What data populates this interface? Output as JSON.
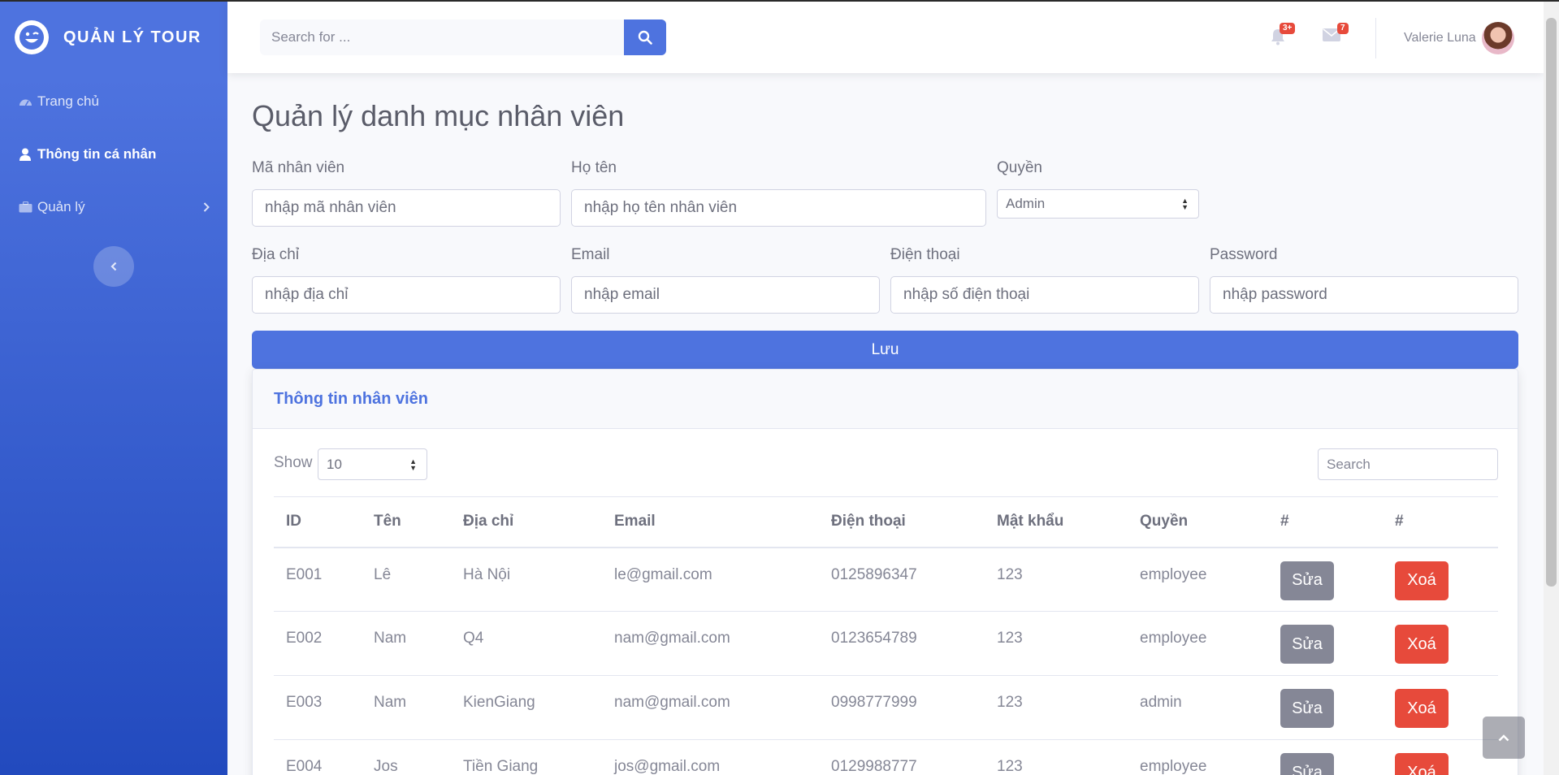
{
  "brand": {
    "name": "QUẢN LÝ TOUR",
    "logo_icon": "laugh-wink-icon"
  },
  "sidebar": {
    "items": [
      {
        "label": "Trang chủ",
        "icon": "tachometer-icon"
      },
      {
        "label": "Thông tin cá nhân",
        "icon": "user-icon"
      },
      {
        "label": "Quản lý",
        "icon": "briefcase-icon"
      }
    ]
  },
  "topbar": {
    "search_placeholder": "Search for ...",
    "alerts_badge": "3+",
    "messages_badge": "7",
    "user_name": "Valerie Luna"
  },
  "page": {
    "title": "Quản lý danh mục nhân viên"
  },
  "form": {
    "ma_label": "Mã nhân viên",
    "ma_placeholder": "nhập mã nhân viên",
    "hoten_label": "Họ tên",
    "hoten_placeholder": "nhập họ tên nhân viên",
    "quyen_label": "Quyền",
    "quyen_value": "Admin",
    "diachi_label": "Địa chỉ",
    "diachi_placeholder": "nhập địa chỉ",
    "email_label": "Email",
    "email_placeholder": "nhập email",
    "dienthoai_label": "Điện thoại",
    "dienthoai_placeholder": "nhập số điện thoại",
    "password_label": "Password",
    "password_placeholder": "nhập password",
    "save_label": "Lưu"
  },
  "table_card": {
    "title": "Thông tin nhân viên",
    "show_label": "Show",
    "page_size": "10",
    "search_placeholder": "Search",
    "columns": [
      "ID",
      "Tên",
      "Địa chỉ",
      "Email",
      "Điện thoại",
      "Mật khẩu",
      "Quyền",
      "#",
      "#"
    ],
    "edit_label": "Sửa",
    "delete_label": "Xoá",
    "rows": [
      [
        "E001",
        "Lê",
        "Hà Nội",
        "le@gmail.com",
        "0125896347",
        "123",
        "employee"
      ],
      [
        "E002",
        "Nam",
        "Q4",
        "nam@gmail.com",
        "0123654789",
        "123",
        "employee"
      ],
      [
        "E003",
        "Nam",
        "KienGiang",
        "nam@gmail.com",
        "0998777999",
        "123",
        "admin"
      ],
      [
        "E004",
        "Jos",
        "Tiền Giang",
        "jos@gmail.com",
        "0129988777",
        "123",
        "employee"
      ]
    ]
  },
  "colors": {
    "primary": "#4e73df",
    "danger": "#e74a3b",
    "secondary": "#858796"
  }
}
